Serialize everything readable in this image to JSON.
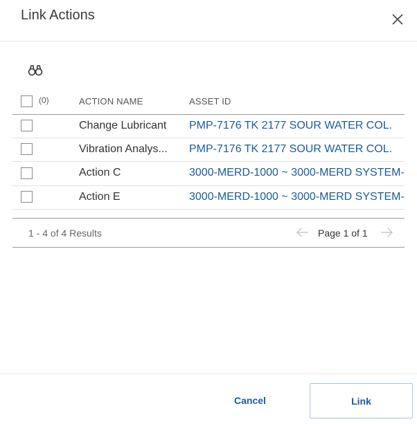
{
  "dialog": {
    "title": "Link Actions",
    "close_icon": "close-icon",
    "search_icon": "binoculars-icon"
  },
  "table": {
    "select_count": "(0)",
    "columns": [
      "ACTION NAME",
      "ASSET ID"
    ],
    "rows": [
      {
        "action_name": "Change Lubricant",
        "asset_id": "PMP-7176 TK 2177 SOUR WATER COL.",
        "checked": false
      },
      {
        "action_name": "Vibration Analys...",
        "asset_id": "PMP-7176 TK 2177 SOUR WATER COL.",
        "checked": false
      },
      {
        "action_name": "Action C",
        "asset_id": "3000-MERD-1000 ~ 3000-MERD SYSTEM-",
        "checked": false
      },
      {
        "action_name": "Action E",
        "asset_id": "3000-MERD-1000 ~ 3000-MERD SYSTEM-",
        "checked": false
      }
    ]
  },
  "pagination": {
    "results": "1 - 4 of 4 Results",
    "page_label": "Page 1 of 1",
    "prev_icon": "arrow-left-icon",
    "next_icon": "arrow-right-icon"
  },
  "footer": {
    "cancel_label": "Cancel",
    "link_label": "Link"
  },
  "colors": {
    "link_text": "#1a5a9e",
    "divider": "#e2e2e2"
  }
}
